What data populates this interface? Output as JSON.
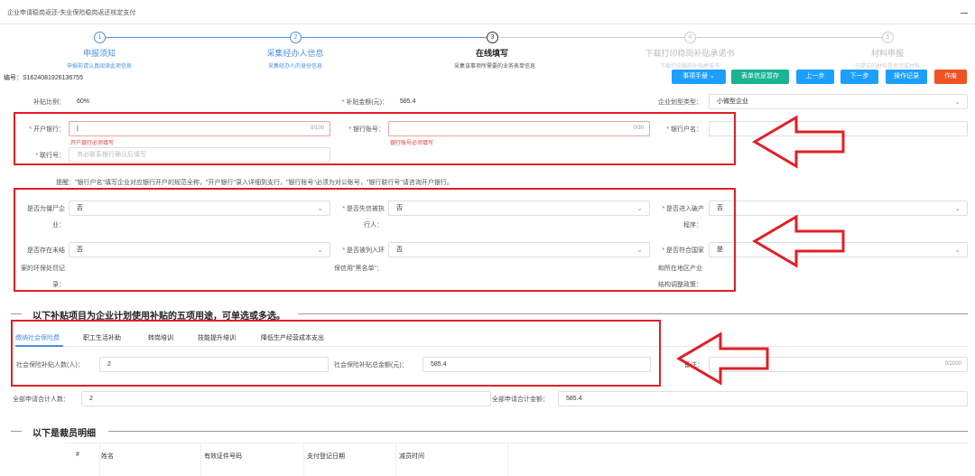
{
  "header": {
    "title": "企业申请稳岗返还-失业保险稳岗返还核定支付"
  },
  "steps": [
    {
      "num": "1",
      "title": "申报须知",
      "desc": "申报前请认真阅读此项信息"
    },
    {
      "num": "2",
      "title": "采集经办人信息",
      "desc": "采集经办人的身份信息"
    },
    {
      "num": "3",
      "title": "在线填写",
      "desc": "采集该事项所需要的业务表单信息"
    },
    {
      "num": "4",
      "title": "下载打印稳岗补贴承诺书",
      "desc": "下载打印稳岗补贴承诺书"
    },
    {
      "num": "5",
      "title": "材料申报",
      "desc": "已提交的材料是否完成材料"
    }
  ],
  "code_label": "编号：S1624081926136755",
  "buttons": {
    "manual": "事项手册",
    "save_form": "表单信息暂存",
    "prev": "上一步",
    "next": "下一步",
    "log": "操作记录",
    "void": "作废"
  },
  "form": {
    "subsidy_ratio_label": "补贴比例：",
    "subsidy_ratio_value": "60%",
    "subsidy_amount_label": "补贴金额(元)：",
    "subsidy_amount_value": "585.4",
    "enterprise_type_label": "企业划型类型：",
    "enterprise_type_value": "小微型企业",
    "bank_label": "开户银行：",
    "bank_value": "|",
    "bank_count": "0/100",
    "bank_error": "开户银行必须填写",
    "account_label": "银行账号：",
    "account_count": "0/30",
    "account_error": "银行账号必须填写",
    "account_name_label": "银行户名：",
    "union_no_label": "联行号：",
    "union_no_placeholder": "务必联系银行确认后填写",
    "tip": "提醒：\"银行户名\"填写企业对应银行开户的规范全称，\"开户银行\"录入详细到支行，\"银行账号\"必须为对公账号，\"银行联行号\"请咨询开户银行。",
    "q1_label_a": "是否为僵尸企",
    "q1_label_b": "业：",
    "q1_value": "否",
    "q2_label_a": "是否失信被执",
    "q2_label_b": "行人：",
    "q2_value": "否",
    "q3_label_a": "是否进入破产",
    "q3_label_b": "程序：",
    "q3_value": "否",
    "q4_label_a": "是否存在未结",
    "q4_label_b": "案的环保处罚记",
    "q4_label_c": "录：",
    "q4_value": "否",
    "q5_label_a": "是否被列入环",
    "q5_label_b": "保信用\"黑名单\"：",
    "q5_value": "否",
    "q6_label_a": "是否符合国家",
    "q6_label_b": "和所在地区产业",
    "q6_label_c": "结构调整政策：",
    "q6_value": "是"
  },
  "section1_title": "以下补贴项目为企业计划使用补贴的五项用途，可单选或多选。",
  "tabs": [
    "缴纳社会保险费",
    "职工生活补助",
    "转岗培训",
    "技能提升培训",
    "降低生产经营成本支出"
  ],
  "tab_form": {
    "people_label": "社会保险补贴人数(人)：",
    "people_value": "2",
    "total_label": "社会保险补贴总金额(元)：",
    "total_value": "585.4",
    "remark_label": "备注：",
    "remark_count": "0/2000"
  },
  "totals": {
    "people_label": "全部申请合计人数：",
    "people_value": "2",
    "amount_label": "全部申请合计金额：",
    "amount_value": "585.4"
  },
  "section2_title": "以下是裁员明细",
  "table_headers": [
    "#",
    "姓名",
    "有效证件号码",
    "支付登记日期",
    "减员时间"
  ],
  "colors": {
    "accent": "#4a90e2",
    "highlight": "#e01f26",
    "green": "#1ab394",
    "cyan": "#1e9fff",
    "red": "#f05323"
  }
}
